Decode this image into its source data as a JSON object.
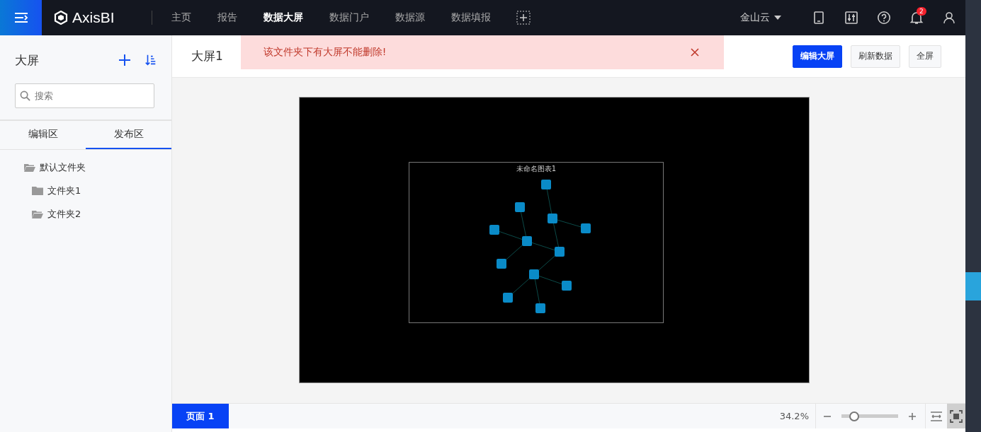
{
  "app": {
    "name": "AxisBI"
  },
  "nav": [
    {
      "label": "主页",
      "selected": false
    },
    {
      "label": "报告",
      "selected": false
    },
    {
      "label": "数据大屏",
      "selected": true
    },
    {
      "label": "数据门户",
      "selected": false
    },
    {
      "label": "数据源",
      "selected": false
    },
    {
      "label": "数据填报",
      "selected": false
    }
  ],
  "user": {
    "org": "金山云",
    "notifications": "2"
  },
  "sidebar": {
    "title": "大屏",
    "search": {
      "placeholder": "搜索"
    },
    "tabs": [
      {
        "label": "编辑区",
        "selected": false
      },
      {
        "label": "发布区",
        "selected": true
      }
    ],
    "tree": [
      {
        "label": "默认文件夹",
        "expanded": true,
        "children": [
          {
            "label": "文件夹1",
            "expanded": false
          },
          {
            "label": "文件夹2",
            "expanded": true
          }
        ]
      }
    ]
  },
  "header": {
    "title": "大屏1",
    "buttons": [
      {
        "label": "编辑大屏",
        "primary": true
      },
      {
        "label": "刷新数据",
        "primary": false
      },
      {
        "label": "全屏",
        "primary": false
      }
    ]
  },
  "toast": {
    "message": "该文件夹下有大屏不能删除!"
  },
  "preview": {
    "chart_title": "未命名图表1"
  },
  "footer": {
    "pages": [
      {
        "label": "页面 1",
        "selected": true
      }
    ],
    "zoom": "34.2%",
    "slider": {
      "level": 0.22
    }
  }
}
